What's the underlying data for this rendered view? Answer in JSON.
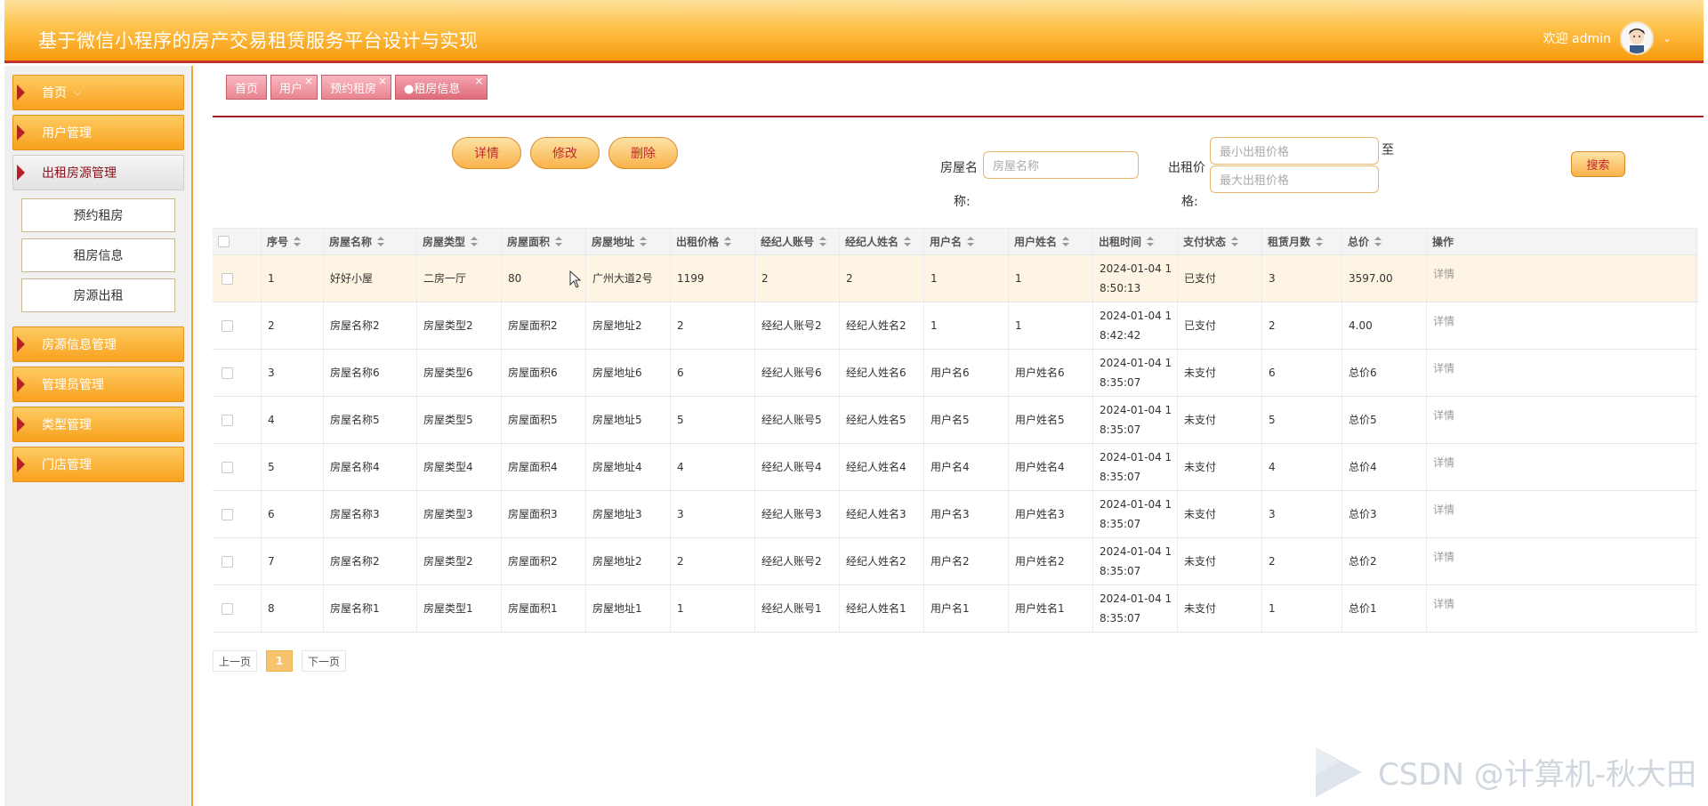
{
  "header": {
    "title": "基于微信小程序的房产交易租赁服务平台设计与实现",
    "welcome": "欢迎 admin"
  },
  "sidebar": {
    "items": [
      {
        "label": "首页",
        "chevron": "⌵"
      },
      {
        "label": "用户管理"
      },
      {
        "label": "出租房源管理"
      },
      {
        "label": "房源信息管理"
      },
      {
        "label": "管理员管理"
      },
      {
        "label": "类型管理"
      },
      {
        "label": "门店管理"
      }
    ],
    "sub_items": [
      {
        "label": "预约租房"
      },
      {
        "label": "租房信息"
      },
      {
        "label": "房源出租"
      }
    ]
  },
  "tabs": [
    {
      "label": "首页"
    },
    {
      "label": "用户",
      "close": "×"
    },
    {
      "label": "预约租房",
      "close": "×"
    },
    {
      "label": "●租房信息",
      "close": "×"
    }
  ],
  "actions": {
    "detail": "详情",
    "edit": "修改",
    "delete": "删除"
  },
  "search": {
    "house_label_a": "房屋名",
    "house_label_b": "称:",
    "house_placeholder": "房屋名称",
    "price_label_a": "出租价",
    "price_label_b": "格:",
    "min_placeholder": "最小出租价格",
    "max_placeholder": "最大出租价格",
    "to_label": "至",
    "button": "搜索"
  },
  "table": {
    "columns": [
      "序号",
      "房屋名称",
      "房屋类型",
      "房屋面积",
      "房屋地址",
      "出租价格",
      "经纪人账号",
      "经纪人姓名",
      "用户名",
      "用户姓名",
      "出租时间",
      "支付状态",
      "租赁月数",
      "总价",
      "操作"
    ],
    "rows": [
      {
        "id": "1",
        "name": "好好小屋",
        "type": "二房一厅",
        "area": "80",
        "addr": "广州大道2号",
        "price": "1199",
        "agent_acct": "2",
        "agent_name": "2",
        "user": "1",
        "user_name": "1",
        "time_a": "2024-01-04 1",
        "time_b": "8:50:13",
        "status": "已支付",
        "months": "3",
        "total": "3597.00",
        "op": "详情"
      },
      {
        "id": "2",
        "name": "房屋名称2",
        "type": "房屋类型2",
        "area": "房屋面积2",
        "addr": "房屋地址2",
        "price": "2",
        "agent_acct": "经纪人账号2",
        "agent_name": "经纪人姓名2",
        "user": "1",
        "user_name": "1",
        "time_a": "2024-01-04 1",
        "time_b": "8:42:42",
        "status": "已支付",
        "months": "2",
        "total": "4.00",
        "op": "详情"
      },
      {
        "id": "3",
        "name": "房屋名称6",
        "type": "房屋类型6",
        "area": "房屋面积6",
        "addr": "房屋地址6",
        "price": "6",
        "agent_acct": "经纪人账号6",
        "agent_name": "经纪人姓名6",
        "user": "用户名6",
        "user_name": "用户姓名6",
        "time_a": "2024-01-04 1",
        "time_b": "8:35:07",
        "status": "未支付",
        "months": "6",
        "total": "总价6",
        "op": "详情"
      },
      {
        "id": "4",
        "name": "房屋名称5",
        "type": "房屋类型5",
        "area": "房屋面积5",
        "addr": "房屋地址5",
        "price": "5",
        "agent_acct": "经纪人账号5",
        "agent_name": "经纪人姓名5",
        "user": "用户名5",
        "user_name": "用户姓名5",
        "time_a": "2024-01-04 1",
        "time_b": "8:35:07",
        "status": "未支付",
        "months": "5",
        "total": "总价5",
        "op": "详情"
      },
      {
        "id": "5",
        "name": "房屋名称4",
        "type": "房屋类型4",
        "area": "房屋面积4",
        "addr": "房屋地址4",
        "price": "4",
        "agent_acct": "经纪人账号4",
        "agent_name": "经纪人姓名4",
        "user": "用户名4",
        "user_name": "用户姓名4",
        "time_a": "2024-01-04 1",
        "time_b": "8:35:07",
        "status": "未支付",
        "months": "4",
        "total": "总价4",
        "op": "详情"
      },
      {
        "id": "6",
        "name": "房屋名称3",
        "type": "房屋类型3",
        "area": "房屋面积3",
        "addr": "房屋地址3",
        "price": "3",
        "agent_acct": "经纪人账号3",
        "agent_name": "经纪人姓名3",
        "user": "用户名3",
        "user_name": "用户姓名3",
        "time_a": "2024-01-04 1",
        "time_b": "8:35:07",
        "status": "未支付",
        "months": "3",
        "total": "总价3",
        "op": "详情"
      },
      {
        "id": "7",
        "name": "房屋名称2",
        "type": "房屋类型2",
        "area": "房屋面积2",
        "addr": "房屋地址2",
        "price": "2",
        "agent_acct": "经纪人账号2",
        "agent_name": "经纪人姓名2",
        "user": "用户名2",
        "user_name": "用户姓名2",
        "time_a": "2024-01-04 1",
        "time_b": "8:35:07",
        "status": "未支付",
        "months": "2",
        "total": "总价2",
        "op": "详情"
      },
      {
        "id": "8",
        "name": "房屋名称1",
        "type": "房屋类型1",
        "area": "房屋面积1",
        "addr": "房屋地址1",
        "price": "1",
        "agent_acct": "经纪人账号1",
        "agent_name": "经纪人姓名1",
        "user": "用户名1",
        "user_name": "用户姓名1",
        "time_a": "2024-01-04 1",
        "time_b": "8:35:07",
        "status": "未支付",
        "months": "1",
        "total": "总价1",
        "op": "详情"
      }
    ]
  },
  "pagination": {
    "prev": "上一页",
    "current": "1",
    "next": "下一页"
  },
  "watermark": "CSDN @计算机-秋大田",
  "colors": {
    "header_orange": "#f99a0e",
    "accent_red": "#c0282c",
    "tab_pink": "#e8848f"
  }
}
